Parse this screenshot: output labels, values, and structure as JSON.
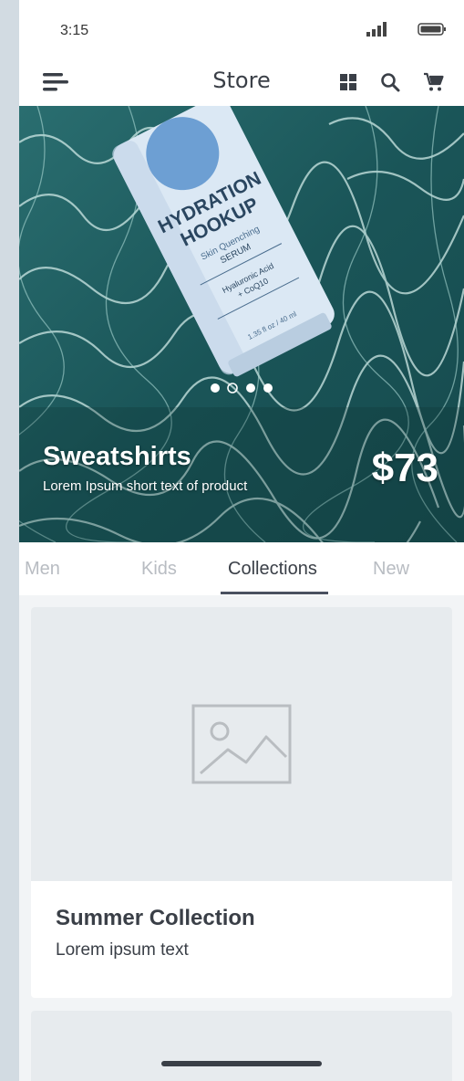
{
  "status": {
    "time": "3:15"
  },
  "appbar": {
    "title": "Store"
  },
  "hero": {
    "title": "Sweatshirts",
    "subtitle": "Lorem Ipsum short text of product",
    "price": "$73",
    "carousel_active_index": 1,
    "carousel_count": 4
  },
  "tabs": [
    {
      "label": "Men",
      "active": false
    },
    {
      "label": "Kids",
      "active": false
    },
    {
      "label": "Collections",
      "active": true
    },
    {
      "label": "New",
      "active": false
    }
  ],
  "cards": [
    {
      "title": "Summer Collection",
      "subtitle": "Lorem ipsum text"
    }
  ],
  "icons": [
    "menu-icon",
    "grid-icon",
    "search-icon",
    "cart-icon",
    "image-placeholder-icon",
    "signal-icon",
    "battery-icon"
  ],
  "colors": {
    "text": "#3a3f47",
    "inactive_tab": "#b8bcc2",
    "placeholder_bg": "#e7ebee",
    "water": "#1c5a5e"
  }
}
